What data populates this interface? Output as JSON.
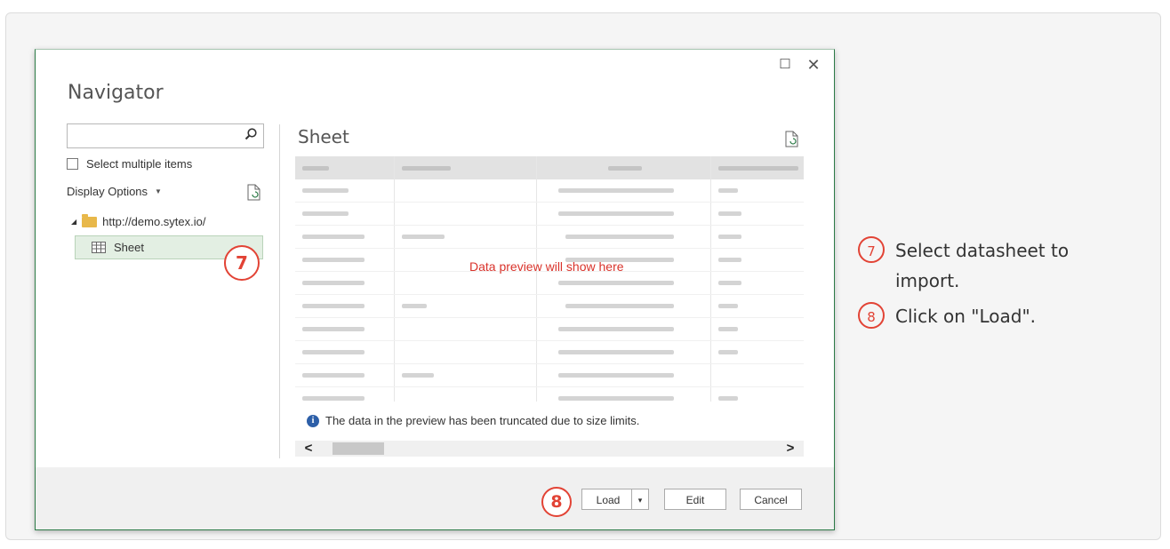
{
  "dialog": {
    "title": "Navigator",
    "maximize_icon": "maximize-icon",
    "close_icon": "close-icon"
  },
  "navigator": {
    "search_placeholder": "",
    "select_multiple_label": "Select multiple items",
    "display_options_label": "Display Options",
    "tree_root_label": "http://demo.sytex.io/",
    "tree_item_label": "Sheet"
  },
  "preview": {
    "title": "Sheet",
    "overlay_text": "Data preview will show here",
    "info_text": "The data in the preview has been truncated due to size limits.",
    "scroll_left": "<",
    "scroll_right": ">"
  },
  "footer": {
    "load_label": "Load",
    "edit_label": "Edit",
    "cancel_label": "Cancel",
    "dropdown_arrow": "▾"
  },
  "callouts": {
    "seven": "7",
    "eight": "8"
  },
  "steps": [
    {
      "number": "7",
      "text": "Select datasheet to import."
    },
    {
      "number": "8",
      "text": "Click on \"Load\"."
    }
  ],
  "colors": {
    "accent": "#e24335",
    "dialog_border": "#2b7a46",
    "selection": "#e3efe3",
    "info_icon": "#2d5fa8"
  }
}
